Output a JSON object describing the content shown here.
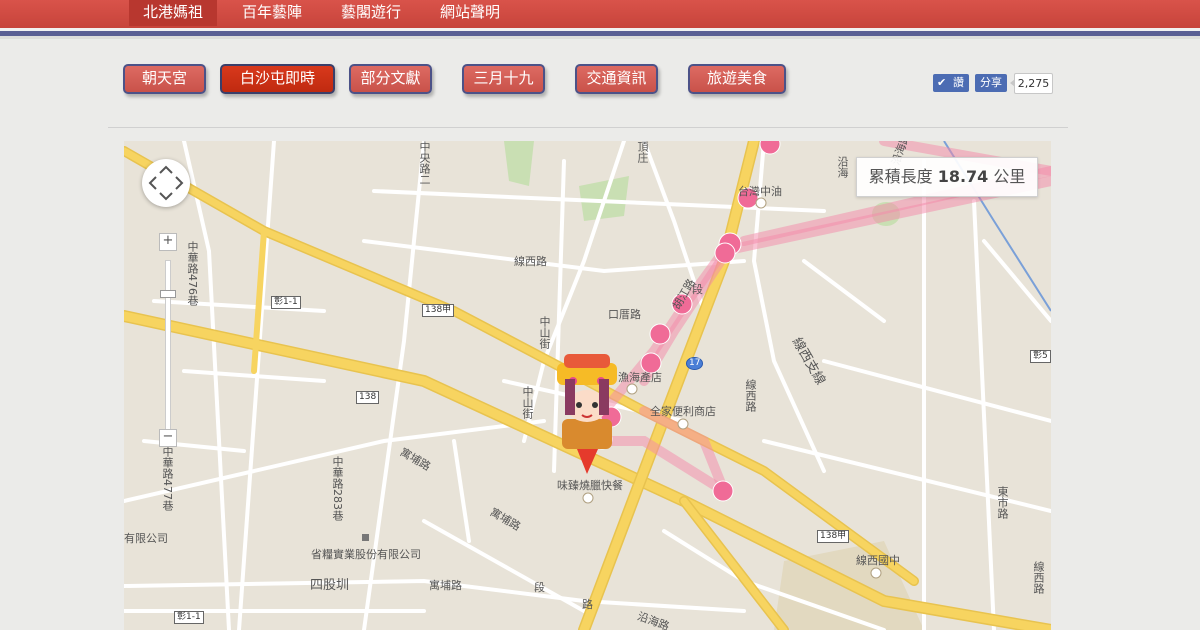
{
  "topnav": {
    "items": [
      {
        "label": "北港媽祖"
      },
      {
        "label": "百年藝陣"
      },
      {
        "label": "藝閣遊行"
      },
      {
        "label": "網站聲明"
      }
    ]
  },
  "tabs": [
    {
      "label": "朝天宮"
    },
    {
      "label": "白沙屯即時"
    },
    {
      "label": "部分文獻"
    },
    {
      "label": "三月十九"
    },
    {
      "label": "交通資訊"
    },
    {
      "label": "旅遊美食"
    }
  ],
  "social": {
    "like_label": "讚",
    "share_label": "分享",
    "count": "2,275"
  },
  "map": {
    "distance_prefix": "累積長度",
    "distance_value": "18.74",
    "distance_unit": "公里",
    "zoom_in": "+",
    "zoom_out": "−",
    "labels": {
      "huaxi_rd": "線西路",
      "zhongshan_st": "中山街",
      "zhongshan_st2": "中山街",
      "kouhu_rd": "口厝路",
      "hujiang": "胡江路",
      "zhonghua_476": "中華路476巷",
      "zhonghua_477": "中華路477巷",
      "zhonghua_283": "中華路283巷",
      "zhongyang_rd2": "中央路二",
      "dingzhuang": "頂庄",
      "taiwan_cpc": "台灣中油",
      "familymart": "全家便利商店",
      "xianxi_branch": "線西支線",
      "wei_zhen": "味臻燒臘快餐",
      "yuhai_shop": "漁海產店",
      "yupu_rd1": "寓埔路",
      "yupu_rd2": "寓埔路",
      "yupu_rd3": "寓埔路",
      "sigu_zun": "四股圳",
      "co_ltd1": "有限公司",
      "co_ltd2": "省糧實業股份有限公司",
      "xianxi_jh": "線西國中",
      "yanhai_rd": "沿海路",
      "yanhai_rd2": "沿海路",
      "xianxi_rd2": "線西路",
      "yanhai_rd3": "沿海",
      "dongshi_rd": "東市路",
      "xianxi_rd3": "線西路",
      "seg_label": "段",
      "seg_label2": "段",
      "road_3": "路"
    },
    "shields": {
      "r138a_1": "138甲",
      "r138a_2": "138甲",
      "r138": "138",
      "r17": "17",
      "chang1_1a": "彰1-1",
      "chang1_1b": "彰1-1",
      "chang5": "彰5"
    },
    "colors": {
      "route": "#f06b97",
      "highway": "#f7d460",
      "road": "#ffffff",
      "park": "#c9dfb3"
    }
  }
}
